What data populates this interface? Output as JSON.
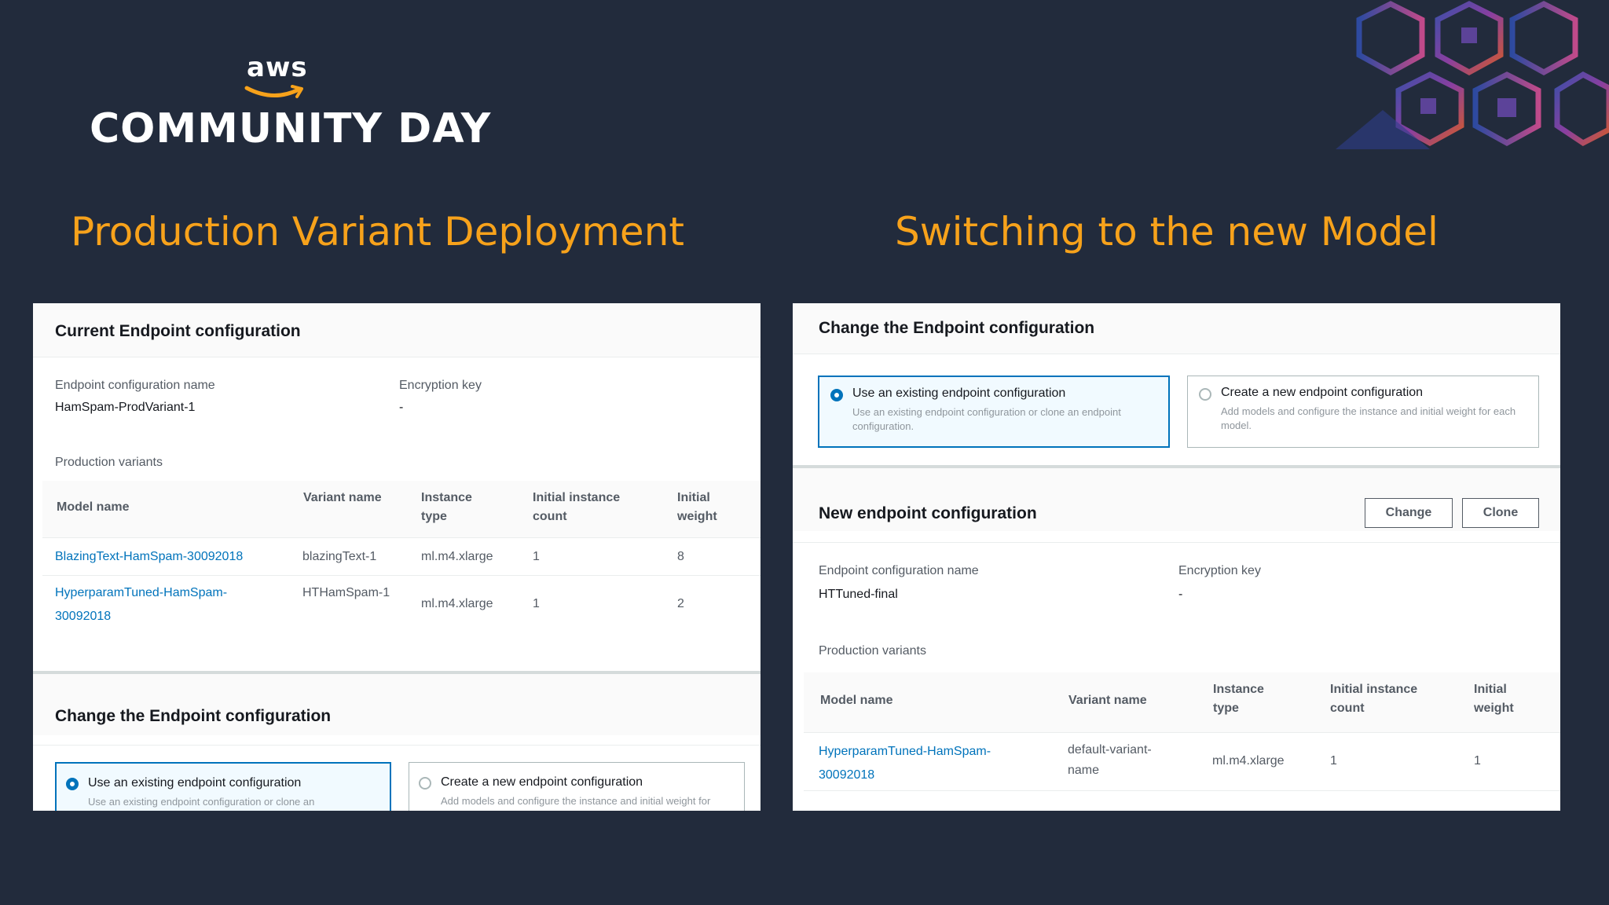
{
  "brand": {
    "aws_word": "aws",
    "event_title": "COMMUNITY DAY"
  },
  "headings": {
    "left": "Production Variant Deployment",
    "right": "Switching to the new Model"
  },
  "left_panel": {
    "current": {
      "title": "Current Endpoint configuration",
      "config_name_label": "Endpoint configuration name",
      "config_name_value": "HamSpam-ProdVariant-1",
      "encryption_label": "Encryption key",
      "encryption_value": "-",
      "variants_label": "Production variants",
      "columns": [
        "Model name",
        "Variant name",
        "Instance type",
        "Initial instance count",
        "Initial weight"
      ],
      "rows": [
        {
          "model": "BlazingText-HamSpam-30092018",
          "variant": "blazingText-1",
          "instance": "ml.m4.xlarge",
          "count": "1",
          "weight": "8"
        },
        {
          "model": "HyperparamTuned-HamSpam-30092018",
          "variant": "HTHamSpam-1",
          "instance": "ml.m4.xlarge",
          "count": "1",
          "weight": "2"
        }
      ]
    },
    "change": {
      "title": "Change the Endpoint configuration",
      "opt_existing_title": "Use an existing endpoint configuration",
      "opt_existing_desc": "Use an existing endpoint configuration or clone an endpoint configuration.",
      "opt_new_title": "Create a new endpoint configuration",
      "opt_new_desc": "Add models and configure the instance and initial weight for each model."
    }
  },
  "right_panel": {
    "change": {
      "title": "Change the Endpoint configuration",
      "opt_existing_title": "Use an existing endpoint configuration",
      "opt_existing_desc": "Use an existing endpoint configuration or clone an endpoint configuration.",
      "opt_new_title": "Create a new endpoint configuration",
      "opt_new_desc": "Add models and configure the instance and initial weight for each model."
    },
    "new_config": {
      "title": "New endpoint configuration",
      "change_button": "Change",
      "clone_button": "Clone",
      "config_name_label": "Endpoint configuration name",
      "config_name_value": "HTTuned-final",
      "encryption_label": "Encryption key",
      "encryption_value": "-",
      "variants_label": "Production variants",
      "columns": [
        "Model name",
        "Variant name",
        "Instance type",
        "Initial instance count",
        "Initial weight"
      ],
      "rows": [
        {
          "model": "HyperparamTuned-HamSpam-30092018",
          "variant": "default-variant-name",
          "instance": "ml.m4.xlarge",
          "count": "1",
          "weight": "1"
        }
      ]
    }
  },
  "colors": {
    "background": "#222b3c",
    "heading": "#f7a21b",
    "link": "#0073bb",
    "selected_border": "#0073bb"
  }
}
